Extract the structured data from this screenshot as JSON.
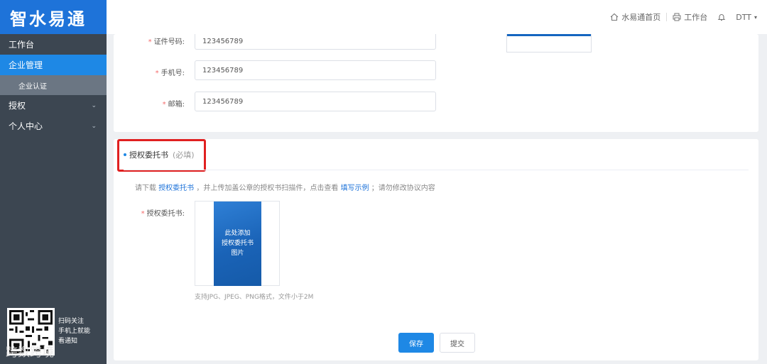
{
  "sidebar": {
    "logo": "智水易通",
    "items": [
      {
        "label": "工作台",
        "active": false
      },
      {
        "label": "企业管理",
        "active": true
      },
      {
        "label": "企业认证",
        "sub": true
      },
      {
        "label": "授权",
        "chevron": "chevron-down-icon"
      },
      {
        "label": "个人中心",
        "chevron": "chevron-down-icon"
      }
    ],
    "qr_text": [
      "扫码关注",
      "手机上就能",
      "看通知"
    ],
    "watermark": "跨数跨境"
  },
  "header": {
    "home_label": "水易通首页",
    "workbench_label": "工作台",
    "user_label": "DTT",
    "icons": [
      "home-icon",
      "printer-icon",
      "bell-icon",
      "caret-down-icon"
    ]
  },
  "form_top": {
    "fields": [
      {
        "label": "证件号码:",
        "value": "123456789",
        "required": true
      },
      {
        "label": "手机号:",
        "value": "123456789",
        "required": true
      },
      {
        "label": "邮箱:",
        "value": "123456789",
        "required": true
      }
    ]
  },
  "auth_section": {
    "title": "授权委托书",
    "optional_tag": "(必填)",
    "hint_prefix": "请下载",
    "hint_link1": "授权委托书",
    "hint_mid": "，并上传加盖公章的授权书扫描件，点击查看",
    "hint_link2": "填写示例",
    "hint_suffix": "；请勿修改协议内容",
    "upload_label": "授权委托书:",
    "upload_placeholder": [
      "此处添加",
      "授权委托书",
      "图片"
    ],
    "upload_note": "支持JPG、JPEG、PNG格式，文件小于2M",
    "save_label": "保存",
    "submit_label": "提交"
  },
  "colors": {
    "sidebar_bg": "#3c4651",
    "accent": "#1e88e5",
    "highlight": "#e02020"
  }
}
